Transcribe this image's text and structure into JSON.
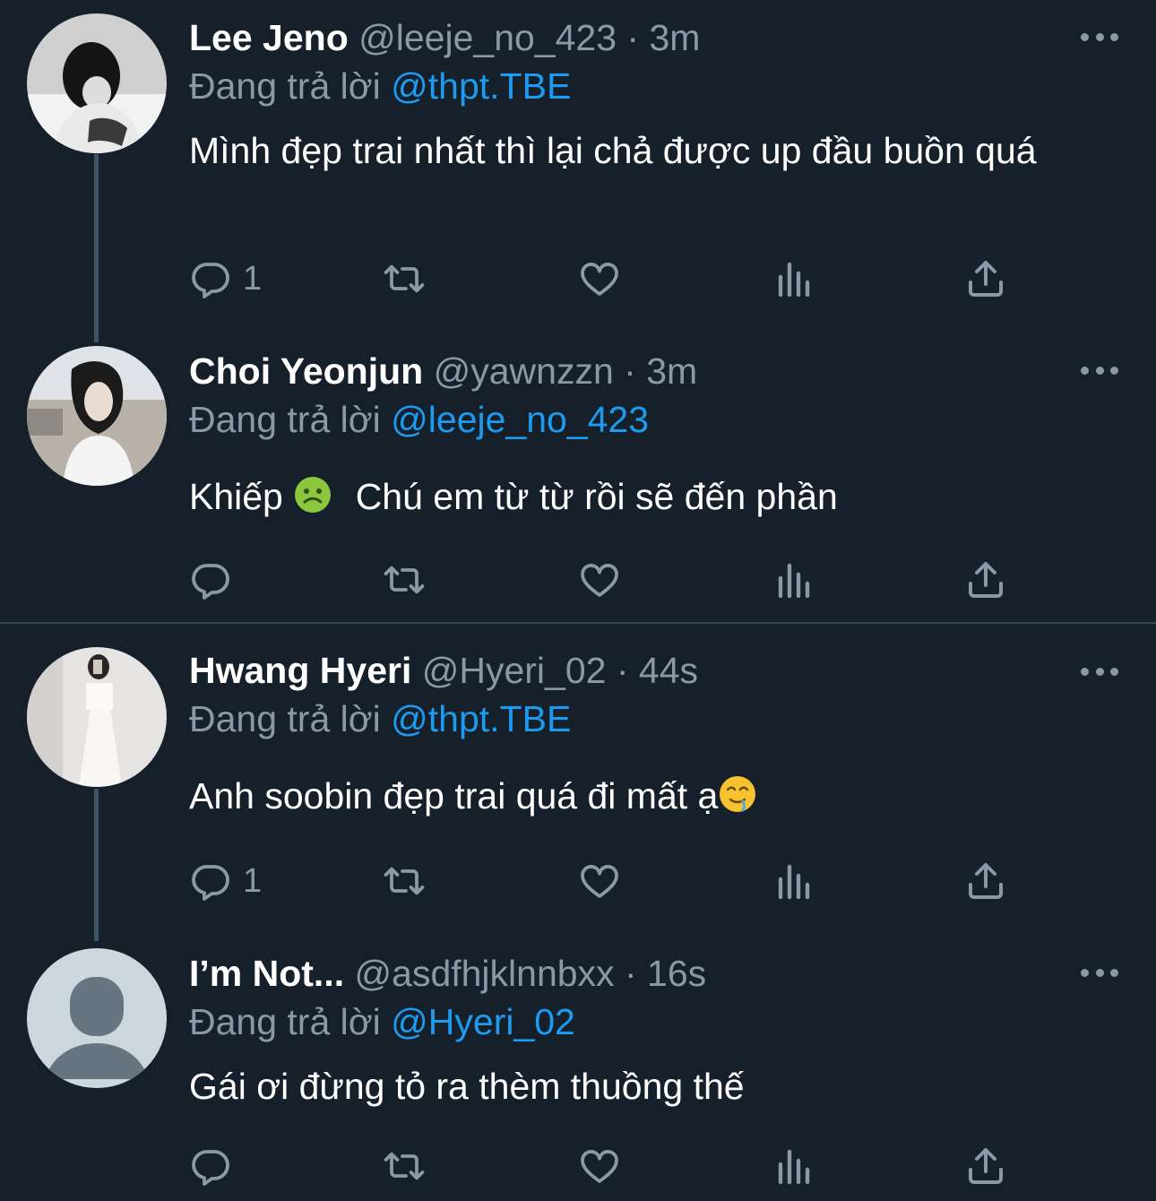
{
  "colors": {
    "background": "#15202b",
    "mention": "#1d9bf0",
    "muted": "#8b98a5",
    "divider": "#38444d"
  },
  "tweets": [
    {
      "name": "Lee Jeno",
      "handle": "@leeje_no_423",
      "dot": "·",
      "time": "3m",
      "reply_prefix": "Đang trả lời",
      "reply_to": "@thpt.TBE",
      "text": "Mình đẹp trai nhất thì lại chả được up đầu buồn quá",
      "reply_count": "1"
    },
    {
      "name": "Choi Yeonjun",
      "handle": "@yawnzzn",
      "dot": "·",
      "time": "3m",
      "reply_prefix": "Đang trả lời",
      "reply_to": "@leeje_no_423",
      "text_before": "Khiếp",
      "text_emoji": "nauseated-face-icon",
      "text_after": "Chú em từ từ rồi sẽ đến phần",
      "reply_count": ""
    },
    {
      "name": "Hwang Hyeri",
      "handle": "@Hyeri_02",
      "dot": "·",
      "time": "44s",
      "reply_prefix": "Đang trả lời",
      "reply_to": "@thpt.TBE",
      "text_before": "Anh soobin đẹp trai quá đi mất ạ",
      "text_emoji": "drooling-face-icon",
      "reply_count": "1"
    },
    {
      "name": "I’m Not...",
      "handle": "@asdfhjklnnbxx",
      "dot": "·",
      "time": "16s",
      "reply_prefix": "Đang trả lời",
      "reply_to": "@Hyeri_02",
      "text": "Gái ơi đừng tỏ ra thèm thuồng thế",
      "reply_count": ""
    }
  ],
  "icons": [
    "reply-icon",
    "retweet-icon",
    "like-icon",
    "analytics-icon",
    "share-icon",
    "more-icon"
  ]
}
